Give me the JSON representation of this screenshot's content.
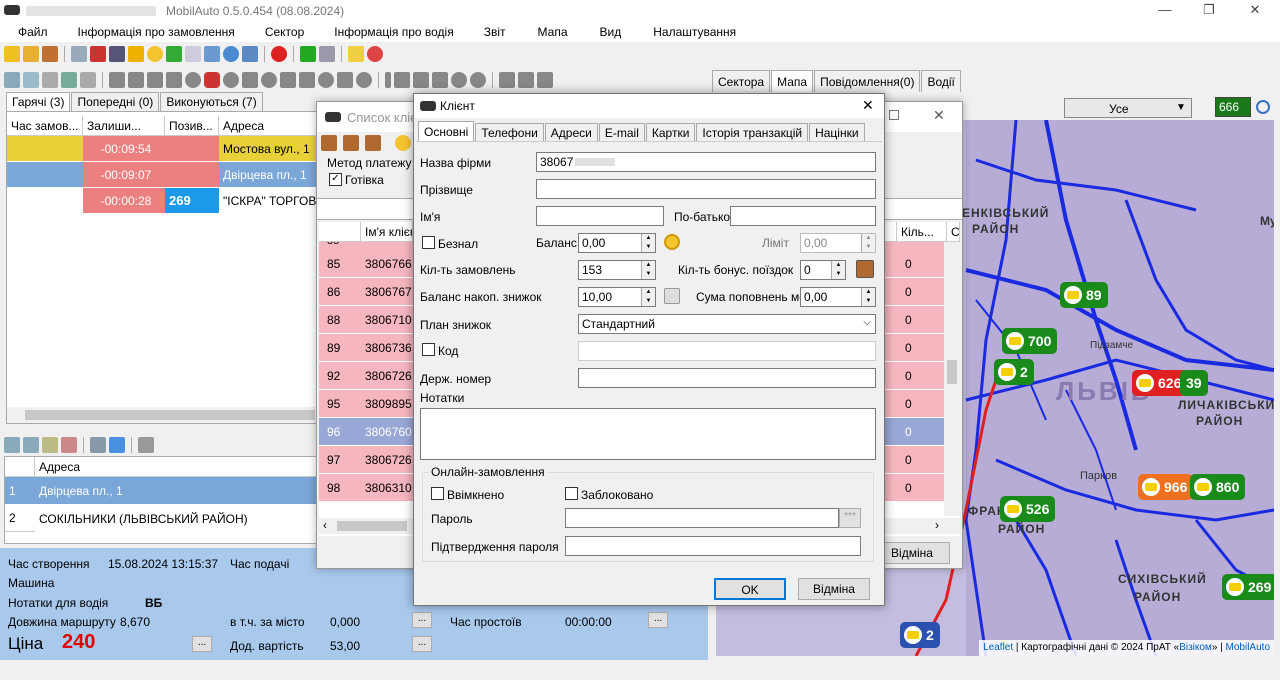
{
  "window": {
    "title_blurred": "",
    "title": "MobilAuto 0.5.0.454 (08.08.2024)"
  },
  "menu": [
    "Файл",
    "Інформація про замовлення",
    "Сектор",
    "Інформація про водія",
    "Звіт",
    "Мапа",
    "Вид",
    "Налаштування"
  ],
  "left_tabs": [
    "Гарячі (3)",
    "Попередні (0)",
    "Виконуються (7)"
  ],
  "orders_header": [
    "Час замов...",
    "Залиши...",
    "Позив...",
    "Адреса"
  ],
  "orders": [
    {
      "time": "",
      "left": "-00:09:54",
      "callsign": "",
      "address": "Мостова вул., 1",
      "color": "#e8d038"
    },
    {
      "time": "",
      "left": "-00:09:07",
      "callsign": "",
      "address": "Двірцева пл., 1",
      "color": "#7aa6d8"
    },
    {
      "time": "",
      "left": "-00:00:28",
      "callsign": "269",
      "address": "\"ІСКРА\" ТОРГОВ",
      "color": "#fff"
    }
  ],
  "route_header": [
    "Адреса"
  ],
  "route": [
    {
      "n": "1",
      "address": "Двірцева пл., 1"
    },
    {
      "n": "2",
      "address": "СОКІЛЬНИКИ (ЛЬВІВСЬКИЙ РАЙОН)"
    }
  ],
  "details": {
    "created_label": "Час створення",
    "created": "15.08.2024 13:15:37",
    "submit_label": "Час подачі",
    "car_label": "Машина",
    "driver_notes_label": "Нотатки для водія",
    "driver_notes": "ВБ",
    "route_len_label": "Довжина маршруту",
    "route_len": "8,670",
    "city_label": "в т.ч. за місто",
    "city": "0,000",
    "idle_label": "Час простоїв",
    "idle": "00:00:00",
    "price_label": "Ціна",
    "price": "240",
    "extra_label": "Дод. вартість",
    "extra": "53,00",
    "dots": "..."
  },
  "right_tabs": [
    "Сектора",
    "Мапа",
    "Повідомлення(0)",
    "Водії"
  ],
  "map_filter": {
    "value": "Усе",
    "code": "666"
  },
  "map_labels": [
    "ЕНКІВСЬКИЙ",
    "РАЙОН",
    "ЛЬВІВ",
    "ЛИЧАКІВСЬКИЙ",
    "РАЙОН",
    "Парков",
    "ФРАН",
    "РАЙОН",
    "СИХІВСЬКИЙ",
    "РАЙОН",
    "Підзамче",
    "Му"
  ],
  "map_attrib": {
    "leaflet": "Leaflet",
    "rest": " | Картографічні дані © 2024 ПрАТ «",
    "vizcom": "Візіком",
    "sep": "» | ",
    "mobil": "MobilAuto"
  },
  "markers": [
    {
      "label": "89",
      "color": "#1a8a1a"
    },
    {
      "label": "700",
      "color": "#1a8a1a"
    },
    {
      "label": "2",
      "color": "#1a8a1a"
    },
    {
      "label": "626",
      "color": "#e02020"
    },
    {
      "label": "39",
      "color": "#1a8a1a"
    },
    {
      "label": "966",
      "color": "#f07020"
    },
    {
      "label": "860",
      "color": "#1a8a1a"
    },
    {
      "label": "526",
      "color": "#1a8a1a"
    },
    {
      "label": "269",
      "color": "#1a8a1a"
    },
    {
      "label": "2",
      "color": "#2a50b0"
    }
  ],
  "clients_window": {
    "title": "Список клієнтів",
    "payment_label": "Метод платежу",
    "cash": "Готівка",
    "header": [
      "",
      "Ім'я клієнт...",
      "Кіль..."
    ],
    "rows": [
      {
        "id": "85",
        "phone": "3806766",
        "count": "0",
        "sel": false
      },
      {
        "id": "86",
        "phone": "3806767",
        "count": "0",
        "sel": false
      },
      {
        "id": "88",
        "phone": "3806710",
        "count": "0",
        "sel": false
      },
      {
        "id": "89",
        "phone": "3806736",
        "count": "0",
        "sel": false
      },
      {
        "id": "92",
        "phone": "3806726",
        "count": "0",
        "sel": false
      },
      {
        "id": "95",
        "phone": "3809895",
        "count": "0",
        "sel": false
      },
      {
        "id": "96",
        "phone": "3806760",
        "count": "0",
        "sel": true
      },
      {
        "id": "97",
        "phone": "3806726",
        "count": "0",
        "sel": false
      },
      {
        "id": "98",
        "phone": "3806310",
        "count": "0",
        "sel": false
      }
    ],
    "cancel": "Відміна",
    "c_col": "С"
  },
  "client_dialog": {
    "title": "Клієнт",
    "tabs": [
      "Основні",
      "Телефони",
      "Адреси",
      "E-mail",
      "Картки",
      "Історія транзакцій",
      "Націнки"
    ],
    "company_label": "Назва фірми",
    "company": "38067",
    "surname_label": "Прізвище",
    "name_label": "Ім'я",
    "patronymic_label": "По-батькові",
    "cashless_label": "Безнал",
    "balance_label": "Баланс",
    "balance": "0,00",
    "limit_label": "Ліміт",
    "limit": "0,00",
    "orders_count_label": "Кіл-ть замовлень",
    "orders_count": "153",
    "bonus_label": "Кіл-ть бонус. поїздок",
    "bonus": "0",
    "discount_balance_label": "Баланс накоп. знижок",
    "discount_balance": "10,00",
    "topups_label": "Сума поповнень моб",
    "topups": "0,00",
    "plan_label": "План знижок",
    "plan": "Стандартний",
    "code_label": "Код",
    "plate_label": "Держ. номер",
    "notes_label": "Нотатки",
    "online_label": "Онлайн-замовлення",
    "enabled_label": "Ввімкнено",
    "blocked_label": "Заблоковано",
    "password_label": "Пароль",
    "confirm_label": "Підтвердження пароля",
    "stars": "***",
    "ok": "OK",
    "cancel": "Відміна"
  }
}
